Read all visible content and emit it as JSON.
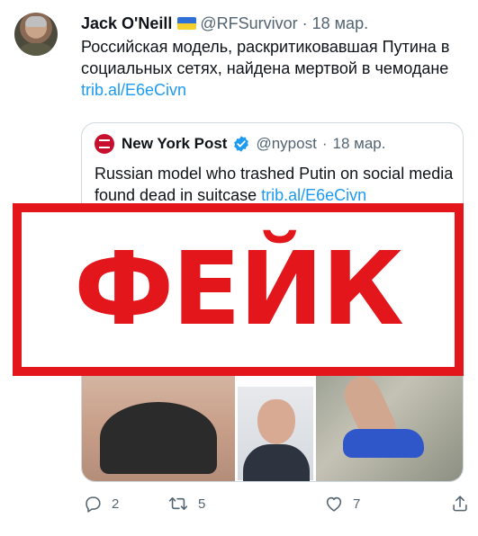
{
  "tweet": {
    "author_name": "Jack O'Neill",
    "author_handle": "@RFSurvivor",
    "separator": "·",
    "date": "18 мар.",
    "text": "Российская модель, раскритиковавшая Путина в социальных сетях, найдена мертвой в чемодане ",
    "link": "trib.al/E6eCivn"
  },
  "quote": {
    "name": "New York Post",
    "handle": "@nypost",
    "separator": "·",
    "date": "18 мар.",
    "text": "Russian model who trashed Putin on social media found dead in suitcase ",
    "link": "trib.al/E6eCivn"
  },
  "overlay": {
    "label": "ФЕЙК",
    "color": "#e3161b"
  },
  "actions": {
    "replies": "2",
    "retweets": "5",
    "likes": "7"
  },
  "icons": [
    "reply-icon",
    "retweet-icon",
    "like-icon",
    "share-icon",
    "verified-icon",
    "ukraine-flag-icon",
    "nypost-logo-icon"
  ],
  "colors": {
    "link": "#1d9bf0",
    "muted": "#536471",
    "verified": "#1d9bf0",
    "fake_red": "#e3161b"
  }
}
